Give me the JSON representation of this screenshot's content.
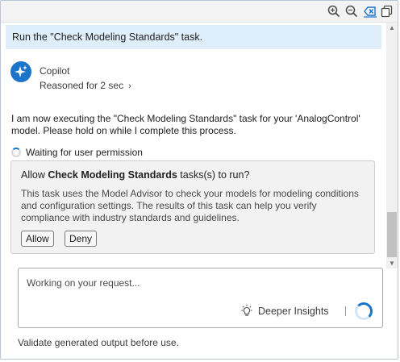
{
  "toolbar": {
    "icons": [
      "zoom-in-icon",
      "zoom-out-icon",
      "clear-icon",
      "copy-icon"
    ]
  },
  "chat": {
    "user_message": "Run the \"Check Modeling Standards\" task.",
    "assistant_name": "Copilot",
    "reasoned": "Reasoned for 2 sec",
    "response": "I am now executing the \"Check Modeling Standards\" task for your 'AnalogControl' model. Please hold on while I complete this process.",
    "waiting": "Waiting for user permission"
  },
  "permission": {
    "title_prefix": "Allow ",
    "title_bold": "Check Modeling Standards",
    "title_suffix": " tasks(s) to run?",
    "description": "This task uses the Model Advisor to check your models for modeling conditions and configuration settings. The results of this task can help you verify compliance with industry standards and guidelines.",
    "allow_label": "Allow",
    "deny_label": "Deny"
  },
  "input": {
    "placeholder": "Working on your request...",
    "insights_label": "Deeper Insights",
    "separator": "|"
  },
  "footer": {
    "disclaimer": "Validate generated output before use."
  },
  "colors": {
    "accent": "#1a74c9",
    "user_bubble": "#dfeefb",
    "card_bg": "#f2f2f2"
  }
}
